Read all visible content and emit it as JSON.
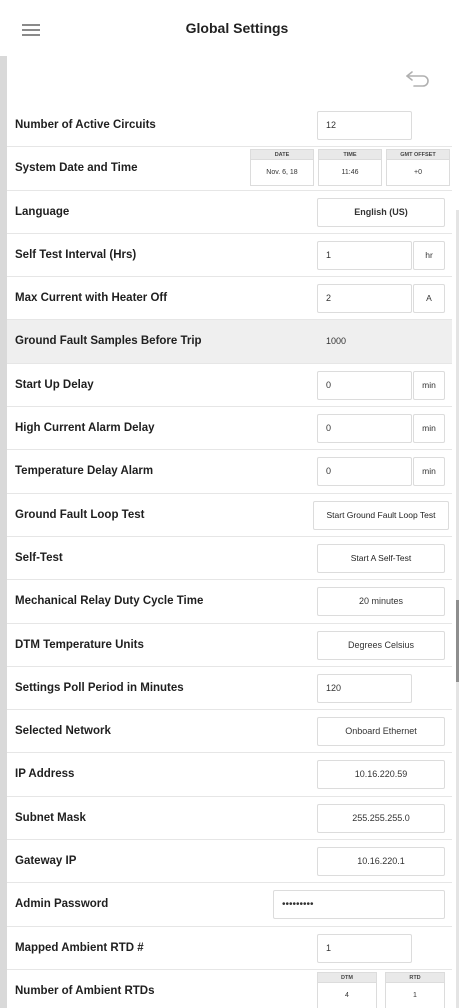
{
  "header": {
    "title": "Global Settings",
    "menu_icon": "hamburger-menu-icon",
    "back_icon": "back-arrow-icon"
  },
  "settings": {
    "active_circuits": {
      "label": "Number of Active Circuits",
      "value": "12"
    },
    "date_time": {
      "label": "System Date and Time",
      "date_caption": "DATE",
      "date_value": "Nov. 6, 18",
      "time_caption": "TIME",
      "time_value": "11:46",
      "offset_caption": "GMT OFFSET",
      "offset_value": "+0"
    },
    "language": {
      "label": "Language",
      "value": "English (US)"
    },
    "self_test_interval": {
      "label": "Self Test Interval (Hrs)",
      "value": "1",
      "unit": "hr"
    },
    "max_current": {
      "label": "Max Current with Heater Off",
      "value": "2",
      "unit": "A"
    },
    "gf_samples": {
      "label": "Ground Fault Samples Before Trip",
      "value": "1000"
    },
    "startup_delay": {
      "label": "Start Up Delay",
      "value": "0",
      "unit": "min"
    },
    "high_current_delay": {
      "label": "High Current Alarm Delay",
      "value": "0",
      "unit": "min"
    },
    "temp_delay": {
      "label": "Temperature Delay Alarm",
      "value": "0",
      "unit": "min"
    },
    "gf_loop_test": {
      "label": "Ground Fault Loop Test",
      "button": "Start Ground Fault Loop Test"
    },
    "self_test": {
      "label": "Self-Test",
      "button": "Start A Self-Test"
    },
    "relay_duty": {
      "label": "Mechanical Relay Duty Cycle Time",
      "value": "20 minutes"
    },
    "temp_units": {
      "label": "DTM Temperature Units",
      "value": "Degrees Celsius"
    },
    "poll_period": {
      "label": "Settings Poll Period in Minutes",
      "value": "120"
    },
    "network": {
      "label": "Selected Network",
      "value": "Onboard Ethernet"
    },
    "ip": {
      "label": "IP Address",
      "value": "10.16.220.59"
    },
    "subnet": {
      "label": "Subnet Mask",
      "value": "255.255.255.0"
    },
    "gateway": {
      "label": "Gateway IP",
      "value": "10.16.220.1"
    },
    "admin_password": {
      "label": "Admin Password",
      "value": "•••••••••"
    },
    "ambient_rtd": {
      "label": "Mapped Ambient RTD #",
      "value": "1"
    },
    "num_ambient_rtds": {
      "label": "Number of Ambient RTDs",
      "dtm_caption": "DTM",
      "dtm_value": "4",
      "rtd_caption": "RTD",
      "rtd_value": "1"
    }
  }
}
